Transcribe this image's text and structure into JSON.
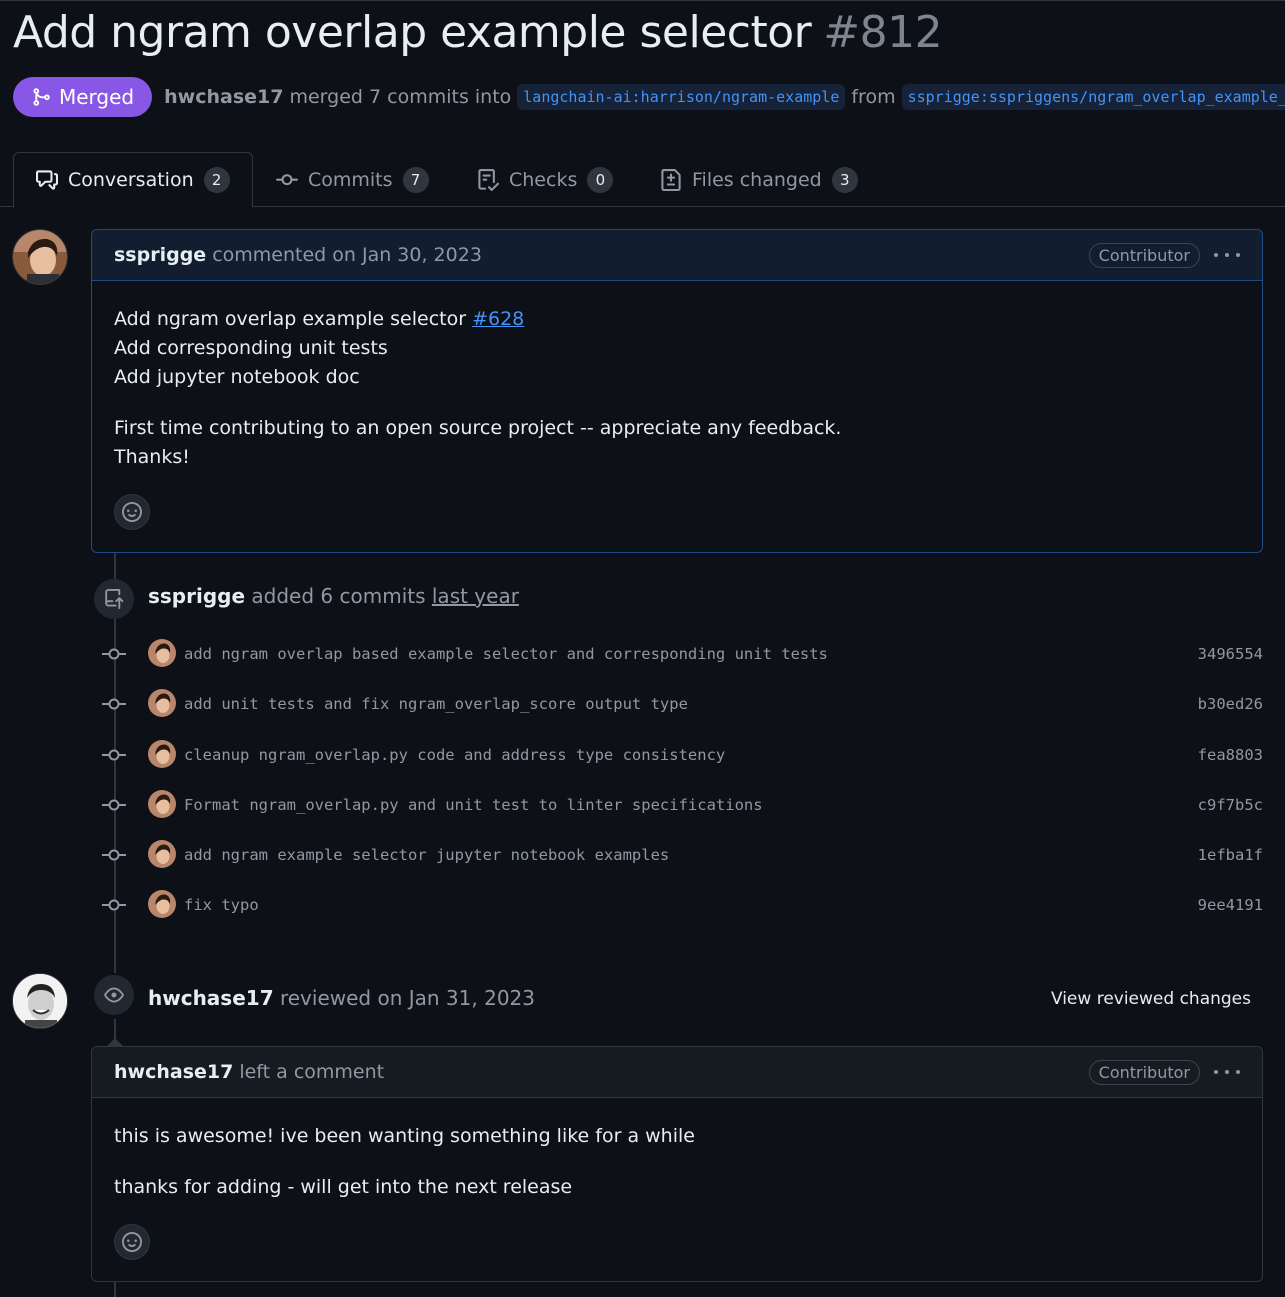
{
  "pr": {
    "title": "Add ngram overlap example selector",
    "number": "#812",
    "status": "Merged",
    "author": "hwchase17",
    "merge_text": "merged 7 commits into",
    "base_branch": "langchain-ai:harrison/ngram-example",
    "from_text": "from",
    "head_branch": "ssprigge:sspriggens/ngram_overlap_example_selector",
    "status_color": "#8957e5"
  },
  "tabs": [
    {
      "label": "Conversation",
      "count": "2",
      "icon": "conversation-icon"
    },
    {
      "label": "Commits",
      "count": "7",
      "icon": "commit-icon"
    },
    {
      "label": "Checks",
      "count": "0",
      "icon": "checklist-icon"
    },
    {
      "label": "Files changed",
      "count": "3",
      "icon": "file-diff-icon"
    }
  ],
  "first_comment": {
    "author": "ssprigge",
    "action": "commented on Jan 30, 2023",
    "role": "Contributor",
    "line1_text": "Add ngram overlap example selector ",
    "line1_link": "#628",
    "line2": "Add corresponding unit tests",
    "line3": "Add jupyter notebook doc",
    "line4": "First time contributing to an open source project -- appreciate any feedback.",
    "line5": "Thanks!"
  },
  "commits_event": {
    "author": "ssprigge",
    "action": "added 6 commits",
    "when": "last year",
    "commits": [
      {
        "message": "add ngram overlap based example selector and corresponding unit tests",
        "sha": "3496554"
      },
      {
        "message": "add unit tests and fix ngram_overlap_score output type",
        "sha": "b30ed26"
      },
      {
        "message": "cleanup ngram_overlap.py code and address type consistency",
        "sha": "fea8803"
      },
      {
        "message": "Format ngram_overlap.py and unit test to linter specifications",
        "sha": "c9f7b5c"
      },
      {
        "message": "add ngram example selector jupyter notebook examples",
        "sha": "1efba1f"
      },
      {
        "message": "fix typo",
        "sha": "9ee4191"
      }
    ]
  },
  "review_event": {
    "author": "hwchase17",
    "action": "reviewed on Jan 31, 2023",
    "view_changes": "View reviewed changes"
  },
  "review_comment": {
    "author": "hwchase17",
    "action": "left a comment",
    "role": "Contributor",
    "para1": "this is awesome! ive been wanting something like for a while",
    "para2": "thanks for adding - will get into the next release"
  }
}
